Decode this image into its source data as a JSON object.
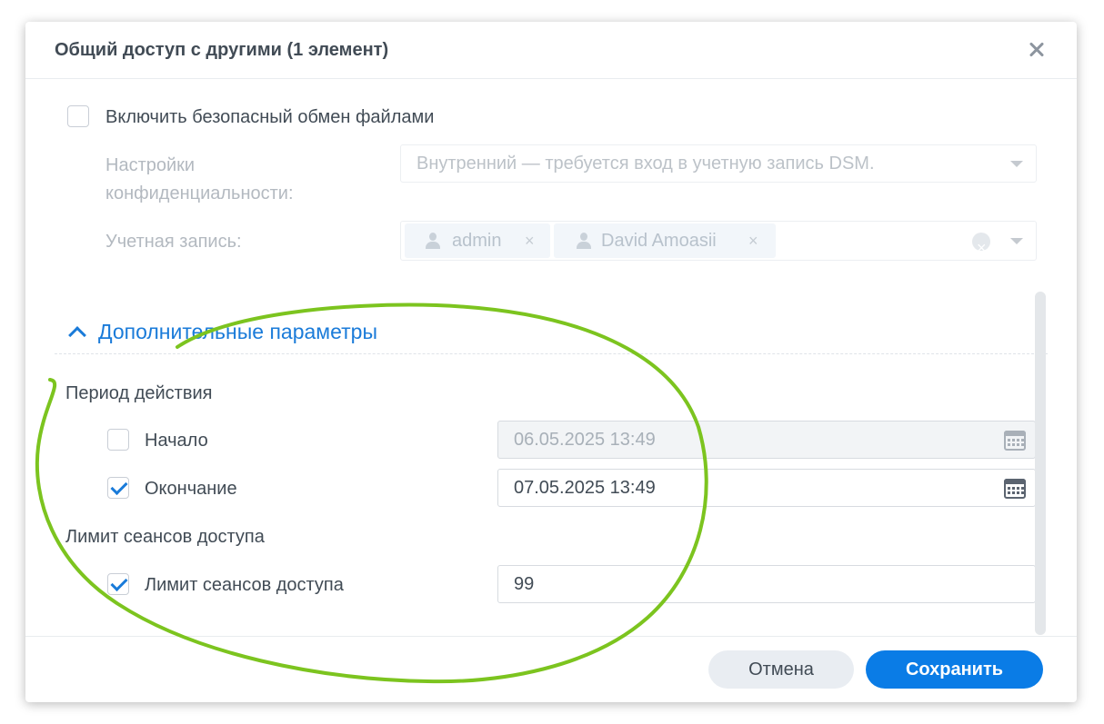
{
  "dialog": {
    "title": "Общий доступ с другими (1 элемент)",
    "close_icon": "close-icon"
  },
  "secure_sharing": {
    "enable_label": "Включить безопасный обмен файлами",
    "checked": false,
    "privacy_label_line1": "Настройки",
    "privacy_label_line2": "конфиденциальности:",
    "privacy_value": "Внутренний — требуется вход в учетную запись DSM.",
    "account_label": "Учетная запись:",
    "accounts": [
      "admin",
      "David Amoasii"
    ]
  },
  "advanced": {
    "title": "Дополнительные параметры",
    "validity_period": {
      "heading": "Период действия",
      "start": {
        "label": "Начало",
        "checked": false,
        "value": "06.05.2025 13:49"
      },
      "end": {
        "label": "Окончание",
        "checked": true,
        "value": "07.05.2025 13:49"
      }
    },
    "access_limit": {
      "heading": "Лимит сеансов доступа",
      "label": "Лимит сеансов доступа",
      "checked": true,
      "value": "99"
    }
  },
  "footer": {
    "cancel_label": "Отмена",
    "save_label": "Сохранить"
  },
  "colors": {
    "accent": "#1a7bd9",
    "primary_button": "#0a7ce6",
    "annotation": "#7cc41f"
  }
}
